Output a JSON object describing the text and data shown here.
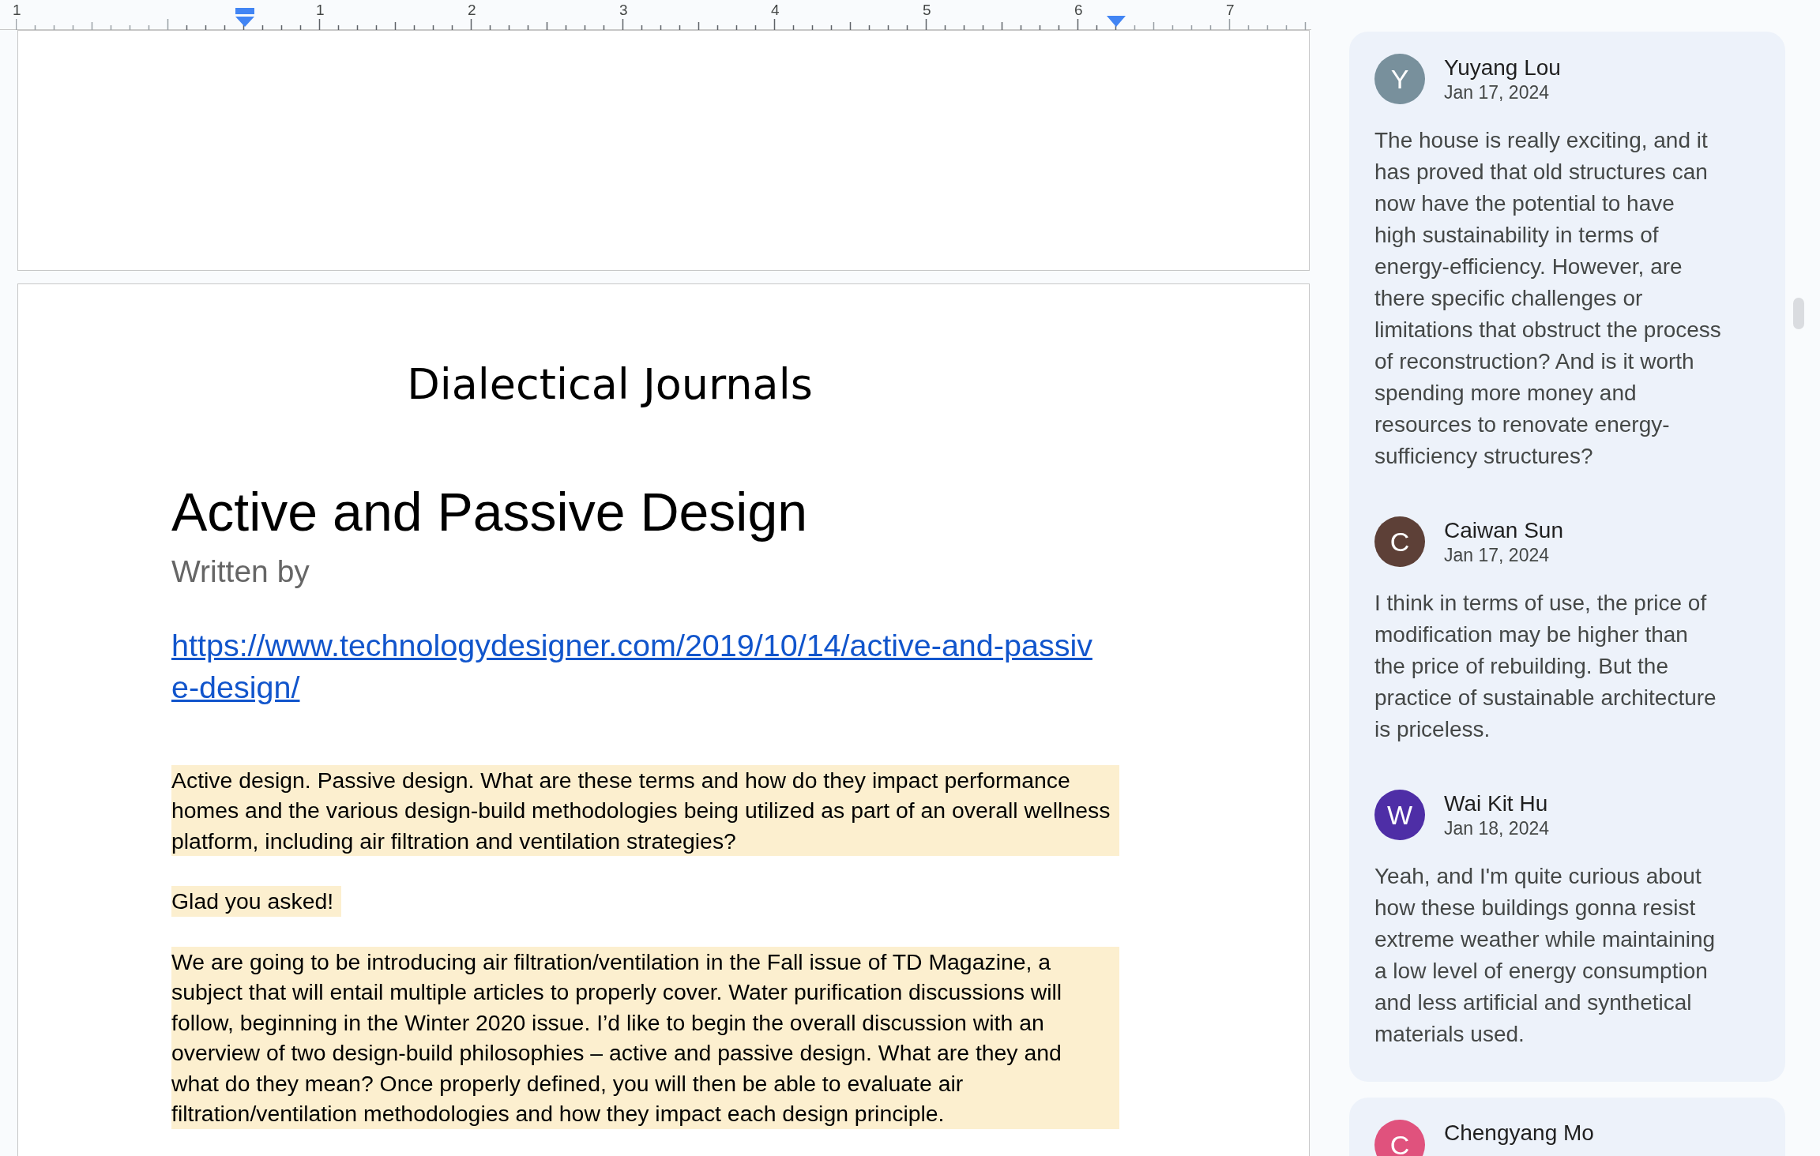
{
  "ruler": {
    "labels": [
      {
        "label": "1"
      },
      {
        "label": "1"
      },
      {
        "label": "2"
      },
      {
        "label": "3"
      },
      {
        "label": "4"
      },
      {
        "label": "5"
      },
      {
        "label": "6"
      },
      {
        "label": "7"
      }
    ]
  },
  "document": {
    "title": "Dialectical Journals",
    "heading": "Active and Passive Design",
    "subtitle": "Written by",
    "link": "https://www.technologydesigner.com/2019/10/14/active-and-passive-design/",
    "paragraphs": [
      {
        "text": "Active design. Passive design. What are these terms and how do they impact performance homes and the various design-build methodologies being utilized as part of an overall wellness platform, including air filtration and ventilation strategies?"
      },
      {
        "text": "Glad you asked!"
      },
      {
        "text": "We are going to be introducing air filtration/ventilation in the Fall issue of TD Magazine, a subject that will entail multiple articles to properly cover. Water purification discussions will follow, beginning in the Winter 2020 issue. I’d like to begin the overall discussion with an overview of two design-build philosophies – active and passive design. What are they and what do they mean? Once properly defined, you will then be able to evaluate air filtration/ventilation methodologies and how they impact each design principle."
      }
    ]
  },
  "comment_threads": [
    {
      "comments": [
        {
          "avatar": "Y",
          "color": "#78909c",
          "author": "Yuyang Lou",
          "date": "Jan 17, 2024",
          "text": "The house is really exciting, and it has proved that old structures can now have the potential to have high sustainability in terms of energy-efficiency. However, are there specific challenges or limitations that obstruct the process of reconstruction? And is it worth spending more money and resources to renovate energy-sufficiency structures?"
        },
        {
          "avatar": "C",
          "color": "#5d4037",
          "author": "Caiwan Sun",
          "date": "Jan 17, 2024",
          "text": "I think in terms of use, the price of modification may be higher than the price of rebuilding. But the practice of sustainable architecture is priceless."
        },
        {
          "avatar": "W",
          "color": "#4e2ea6",
          "author": "Wai Kit Hu",
          "date": "Jan 18, 2024",
          "text": "Yeah, and I'm quite curious about how these buildings gonna resist extreme weather while maintaining a low level of energy consumption and less artificial and synthetical materials used."
        }
      ]
    },
    {
      "comments": [
        {
          "avatar": "C",
          "color": "#e0527d",
          "author": "Chengyang Mo"
        }
      ]
    }
  ]
}
